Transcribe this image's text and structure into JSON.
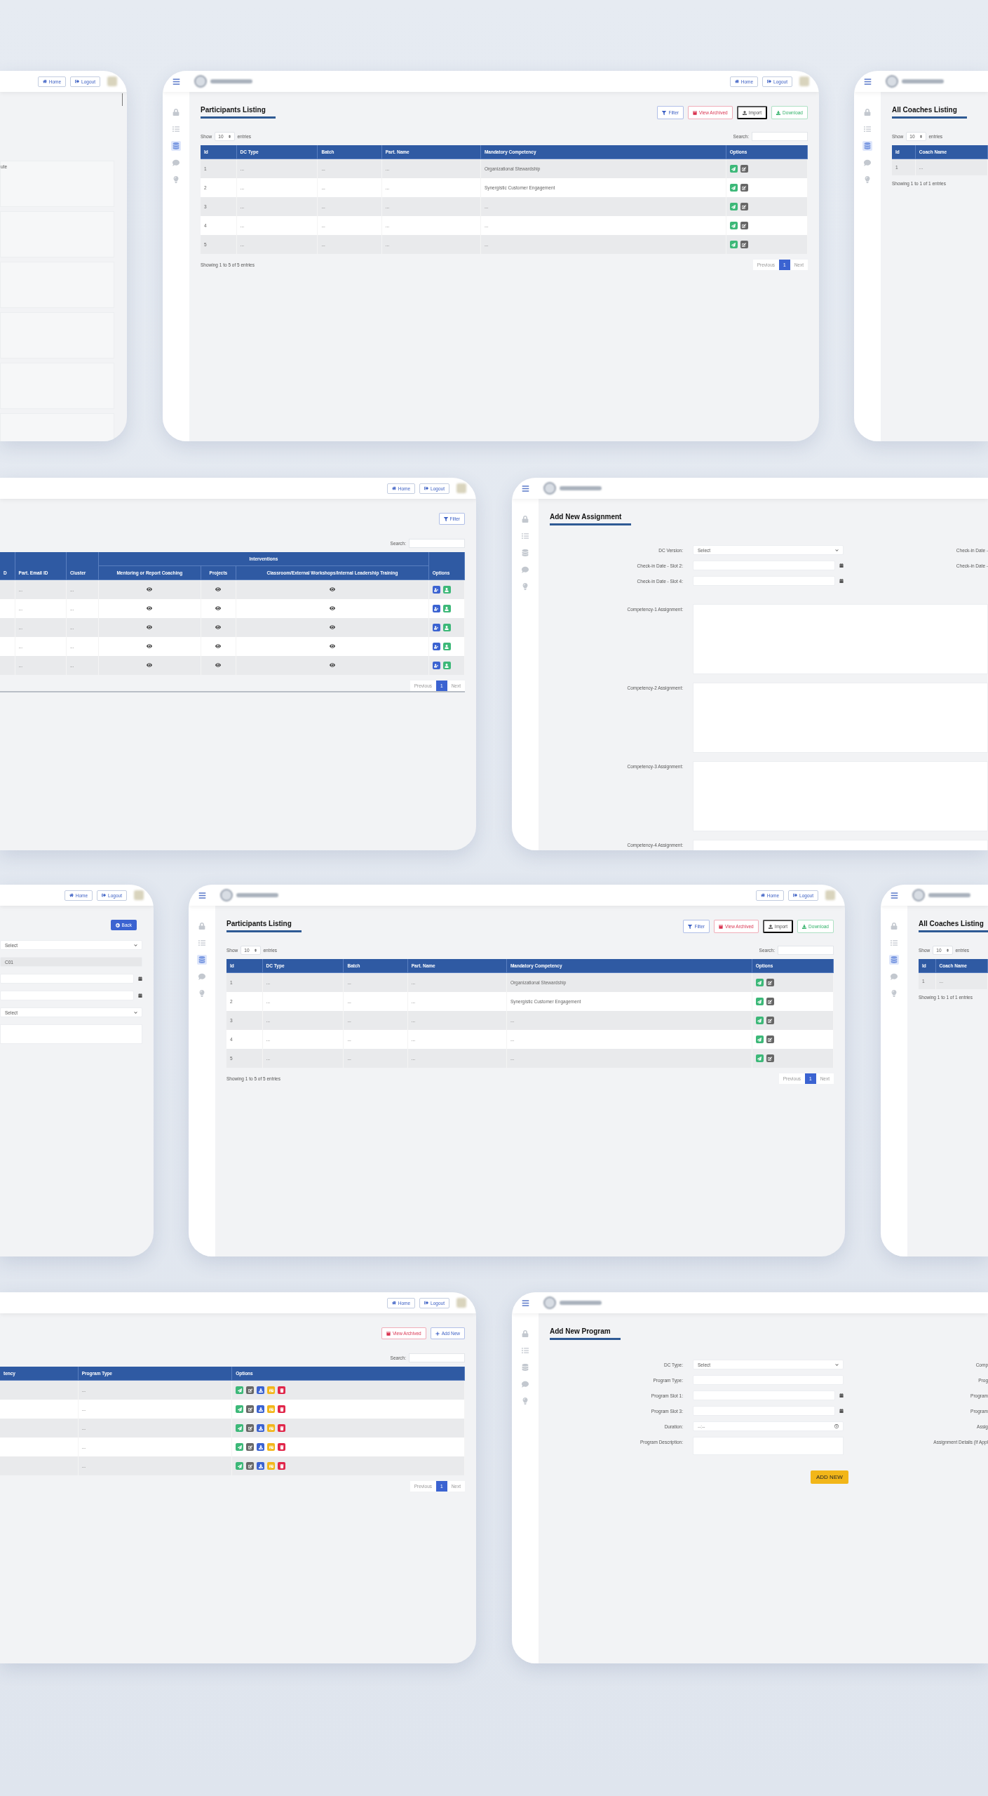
{
  "windows": [
    {
      "kind": "partial_list",
      "header": {
        "menu": false,
        "logo": false,
        "avatar": true,
        "buttons": [
          {
            "label": "Home",
            "kind": "home"
          },
          {
            "label": "Logout",
            "kind": "logout"
          }
        ]
      },
      "note": "ute"
    },
    {
      "kind": "listing",
      "header": {
        "menu": true,
        "logo": true,
        "avatar": true,
        "buttons": [
          {
            "label": "Home",
            "kind": "home"
          },
          {
            "label": "Logout",
            "kind": "logout"
          }
        ]
      },
      "sidebar": [
        {
          "selected": false
        },
        {
          "selected": false
        },
        {
          "selected": true
        },
        {
          "selected": false
        },
        {
          "selected": false
        }
      ],
      "title": "Participants Listing",
      "actions": [
        {
          "label": "Filter",
          "kind": "filter"
        },
        {
          "label": "View Archived",
          "kind": "archive"
        },
        {
          "label": "Import",
          "kind": "import"
        },
        {
          "label": "Download",
          "kind": "download"
        }
      ],
      "show": {
        "label": "Show",
        "value": "10",
        "suffix": "entries"
      },
      "search": "Search:",
      "columns": [
        "Id",
        "DC Type",
        "Batch",
        "Part. Name",
        "Mandatory Competency",
        "Options"
      ],
      "rows": [
        {
          "cells": [
            "1",
            "...",
            "...",
            "...",
            "Organizational Stewardship"
          ],
          "options": [
            {
              "kind": "send"
            },
            {
              "kind": "edit"
            }
          ]
        },
        {
          "cells": [
            "2",
            "...",
            "...",
            "...",
            "Synergistic Customer Engagement"
          ],
          "options": [
            {
              "kind": "send"
            },
            {
              "kind": "edit"
            }
          ]
        },
        {
          "cells": [
            "3",
            "...",
            "...",
            "...",
            "..."
          ],
          "options": [
            {
              "kind": "send"
            },
            {
              "kind": "edit"
            }
          ]
        },
        {
          "cells": [
            "4",
            "...",
            "...",
            "...",
            "..."
          ],
          "options": [
            {
              "kind": "send"
            },
            {
              "kind": "edit"
            }
          ]
        },
        {
          "cells": [
            "5",
            "...",
            "...",
            "...",
            "..."
          ],
          "options": [
            {
              "kind": "send"
            },
            {
              "kind": "edit"
            }
          ]
        }
      ],
      "info": "Showing 1 to 5 of 5 entries",
      "pagination": {
        "previous": "Previous",
        "pages": [
          {
            "label": "1",
            "selected": true
          }
        ],
        "next": "Next"
      }
    },
    {
      "kind": "listing",
      "header": {
        "menu": true,
        "logo": true,
        "avatar": false
      },
      "sidebar": [
        {
          "selected": false
        },
        {
          "selected": false
        },
        {
          "selected": true
        },
        {
          "selected": false
        },
        {
          "selected": false
        }
      ],
      "title": "All Coaches Listing",
      "show": {
        "label": "Show",
        "value": "10",
        "suffix": "entries"
      },
      "columns": [
        "Id",
        "Coach Name"
      ],
      "rows": [
        {
          "cells": [
            "1",
            "..."
          ]
        }
      ],
      "info": "Showing 1 to 1 of 1 entries"
    },
    {
      "kind": "interventions",
      "header": {
        "menu": false,
        "logo": false,
        "avatar": true,
        "buttons": [
          {
            "label": "Home",
            "kind": "home"
          },
          {
            "label": "Logout",
            "kind": "logout"
          }
        ]
      },
      "actions": [
        {
          "label": "Filter",
          "kind": "filter"
        }
      ],
      "search": "Search:",
      "columns": [
        {
          "label": "D"
        },
        {
          "label": "Part. Email ID"
        },
        {
          "label": "Cluster"
        },
        {
          "label": "Interventions",
          "children": [
            {
              "label": "Mentoring or Report Coaching"
            },
            {
              "label": "Projects"
            },
            {
              "label": "Classroom/External Workshops/Internal Leadership Training"
            }
          ]
        },
        {
          "label": "Options"
        }
      ],
      "rows": [
        {
          "cells": [
            "",
            "...",
            "..."
          ],
          "views": [
            {
              "kind": "view"
            },
            {
              "kind": "view"
            },
            {
              "kind": "view"
            }
          ],
          "options": [
            {
              "kind": "assign"
            },
            {
              "kind": "user"
            }
          ]
        },
        {
          "cells": [
            "",
            "...",
            "..."
          ],
          "views": [
            {
              "kind": "view"
            },
            {
              "kind": "view"
            },
            {
              "kind": "view"
            }
          ],
          "options": [
            {
              "kind": "assign"
            },
            {
              "kind": "user"
            }
          ]
        },
        {
          "cells": [
            "",
            "...",
            "..."
          ],
          "views": [
            {
              "kind": "view"
            },
            {
              "kind": "view"
            },
            {
              "kind": "view"
            }
          ],
          "options": [
            {
              "kind": "assign"
            },
            {
              "kind": "user"
            }
          ]
        },
        {
          "cells": [
            "",
            "...",
            "..."
          ],
          "views": [
            {
              "kind": "view"
            },
            {
              "kind": "view"
            },
            {
              "kind": "view"
            }
          ],
          "options": [
            {
              "kind": "assign"
            },
            {
              "kind": "user"
            }
          ]
        },
        {
          "cells": [
            "",
            "...",
            "..."
          ],
          "views": [
            {
              "kind": "view"
            },
            {
              "kind": "view"
            },
            {
              "kind": "view"
            }
          ],
          "options": [
            {
              "kind": "assign"
            },
            {
              "kind": "user"
            }
          ]
        }
      ],
      "pagination": {
        "previous": "Previous",
        "pages": [
          {
            "label": "1",
            "selected": true
          }
        ],
        "next": "Next"
      }
    },
    {
      "kind": "form",
      "header": {
        "menu": true,
        "logo": true,
        "avatar": false
      },
      "sidebar": [
        {
          "selected": false
        },
        {
          "selected": false
        },
        {
          "selected": false
        },
        {
          "selected": false
        },
        {
          "selected": false
        }
      ],
      "title": "Add New Assignment",
      "fields": [
        {
          "label": "DC Version:",
          "kind": "select",
          "value": "Select"
        },
        {
          "label": "Check-in Date - Slot 2:",
          "kind": "date"
        },
        {
          "label": "Check-in Date - Slot 4:",
          "kind": "date"
        }
      ],
      "side_labels": [
        "Check-in Date -",
        "Check-in Date -"
      ],
      "areas": [
        {
          "label": "Competency-1 Assignment:"
        },
        {
          "label": "Competency-2 Assignment:"
        },
        {
          "label": "Competency-3 Assignment:"
        },
        {
          "label": "Competency-4 Assignment:"
        }
      ]
    },
    {
      "kind": "partial_form",
      "header": {
        "menu": false,
        "logo": false,
        "avatar": true,
        "buttons": [
          {
            "label": "Home",
            "kind": "home"
          },
          {
            "label": "Logout",
            "kind": "logout"
          }
        ]
      },
      "back": "Back",
      "fields": [
        {
          "kind": "select",
          "value": "Select"
        },
        {
          "kind": "readonly",
          "value": "C01"
        },
        {
          "kind": "date"
        },
        {
          "kind": "date"
        },
        {
          "kind": "select",
          "value": "Select"
        },
        {
          "kind": "textarea"
        }
      ]
    },
    {
      "kind": "listing",
      "header": {
        "menu": true,
        "logo": true,
        "avatar": true,
        "buttons": [
          {
            "label": "Home",
            "kind": "home"
          },
          {
            "label": "Logout",
            "kind": "logout"
          }
        ]
      },
      "sidebar": [
        {
          "selected": false
        },
        {
          "selected": false
        },
        {
          "selected": true
        },
        {
          "selected": false
        },
        {
          "selected": false
        }
      ],
      "title": "Participants Listing",
      "actions": [
        {
          "label": "Filter",
          "kind": "filter"
        },
        {
          "label": "View Archived",
          "kind": "archive"
        },
        {
          "label": "Import",
          "kind": "import"
        },
        {
          "label": "Download",
          "kind": "download"
        }
      ],
      "show": {
        "label": "Show",
        "value": "10",
        "suffix": "entries"
      },
      "search": "Search:",
      "columns": [
        "Id",
        "DC Type",
        "Batch",
        "Part. Name",
        "Mandatory Competency",
        "Options"
      ],
      "rows": [
        {
          "cells": [
            "1",
            "...",
            "...",
            "...",
            "Organizational Stewardship"
          ],
          "options": [
            {
              "kind": "send"
            },
            {
              "kind": "edit"
            }
          ]
        },
        {
          "cells": [
            "2",
            "...",
            "...",
            "...",
            "Synergistic Customer Engagement"
          ],
          "options": [
            {
              "kind": "send"
            },
            {
              "kind": "edit"
            }
          ]
        },
        {
          "cells": [
            "3",
            "...",
            "...",
            "...",
            "..."
          ],
          "options": [
            {
              "kind": "send"
            },
            {
              "kind": "edit"
            }
          ]
        },
        {
          "cells": [
            "4",
            "...",
            "...",
            "...",
            "..."
          ],
          "options": [
            {
              "kind": "send"
            },
            {
              "kind": "edit"
            }
          ]
        },
        {
          "cells": [
            "5",
            "...",
            "...",
            "...",
            "..."
          ],
          "options": [
            {
              "kind": "send"
            },
            {
              "kind": "edit"
            }
          ]
        }
      ],
      "info": "Showing 1 to 5 of 5 entries",
      "pagination": {
        "previous": "Previous",
        "pages": [
          {
            "label": "1",
            "selected": true
          }
        ],
        "next": "Next"
      }
    },
    {
      "kind": "listing",
      "header": {
        "menu": true,
        "logo": true,
        "avatar": false
      },
      "sidebar": [
        {
          "selected": false
        },
        {
          "selected": false
        },
        {
          "selected": true
        },
        {
          "selected": false
        },
        {
          "selected": false
        }
      ],
      "title": "All Coaches Listing",
      "show": {
        "label": "Show",
        "value": "10",
        "suffix": "entries"
      },
      "columns": [
        "Id",
        "Coach Name"
      ],
      "rows": [
        {
          "cells": [
            "1",
            "..."
          ]
        }
      ],
      "info": "Showing 1 to 1 of 1 entries"
    },
    {
      "kind": "listing",
      "header": {
        "menu": false,
        "logo": false,
        "avatar": true,
        "buttons": [
          {
            "label": "Home",
            "kind": "home"
          },
          {
            "label": "Logout",
            "kind": "logout"
          }
        ]
      },
      "actions": [
        {
          "label": "View Archived",
          "kind": "archive"
        },
        {
          "label": "Add New",
          "kind": "add"
        }
      ],
      "search": "Search:",
      "columns": [
        "tency",
        "Program Type",
        "Options"
      ],
      "rows": [
        {
          "cells": [
            "",
            "..."
          ],
          "options": [
            {
              "kind": "send"
            },
            {
              "kind": "edit"
            },
            {
              "kind": "download"
            },
            {
              "kind": "card"
            },
            {
              "kind": "trash"
            }
          ]
        },
        {
          "cells": [
            "",
            "..."
          ],
          "options": [
            {
              "kind": "send"
            },
            {
              "kind": "edit"
            },
            {
              "kind": "download"
            },
            {
              "kind": "card"
            },
            {
              "kind": "trash"
            }
          ]
        },
        {
          "cells": [
            "",
            "..."
          ],
          "options": [
            {
              "kind": "send"
            },
            {
              "kind": "edit"
            },
            {
              "kind": "download"
            },
            {
              "kind": "card"
            },
            {
              "kind": "trash"
            }
          ]
        },
        {
          "cells": [
            "",
            "..."
          ],
          "options": [
            {
              "kind": "send"
            },
            {
              "kind": "edit"
            },
            {
              "kind": "download"
            },
            {
              "kind": "card"
            },
            {
              "kind": "trash"
            }
          ]
        },
        {
          "cells": [
            "",
            "..."
          ],
          "options": [
            {
              "kind": "send"
            },
            {
              "kind": "edit"
            },
            {
              "kind": "download"
            },
            {
              "kind": "card"
            },
            {
              "kind": "trash"
            }
          ]
        }
      ],
      "pagination": {
        "previous": "Previous",
        "pages": [
          {
            "label": "1",
            "selected": true
          }
        ],
        "next": "Next"
      }
    },
    {
      "kind": "form",
      "header": {
        "menu": true,
        "logo": true,
        "avatar": false
      },
      "sidebar": [
        {
          "selected": false
        },
        {
          "selected": false
        },
        {
          "selected": false
        },
        {
          "selected": false
        },
        {
          "selected": false
        }
      ],
      "title": "Add New Program",
      "fields": [
        {
          "label": "DC Type:",
          "kind": "select",
          "value": "Select"
        },
        {
          "label": "Program Type:",
          "kind": "text"
        },
        {
          "label": "Program Slot 1:",
          "kind": "date"
        },
        {
          "label": "Program Slot 3:",
          "kind": "date"
        },
        {
          "label": "Duration:",
          "kind": "time",
          "placeholder": "--:--"
        },
        {
          "label": "Program Description:",
          "kind": "textarea"
        }
      ],
      "side_labels": [
        "Comp",
        "Prog",
        "Program",
        "Program",
        "Assig",
        "Assignment Details (If Appl"
      ],
      "submit": "ADD NEW"
    }
  ]
}
